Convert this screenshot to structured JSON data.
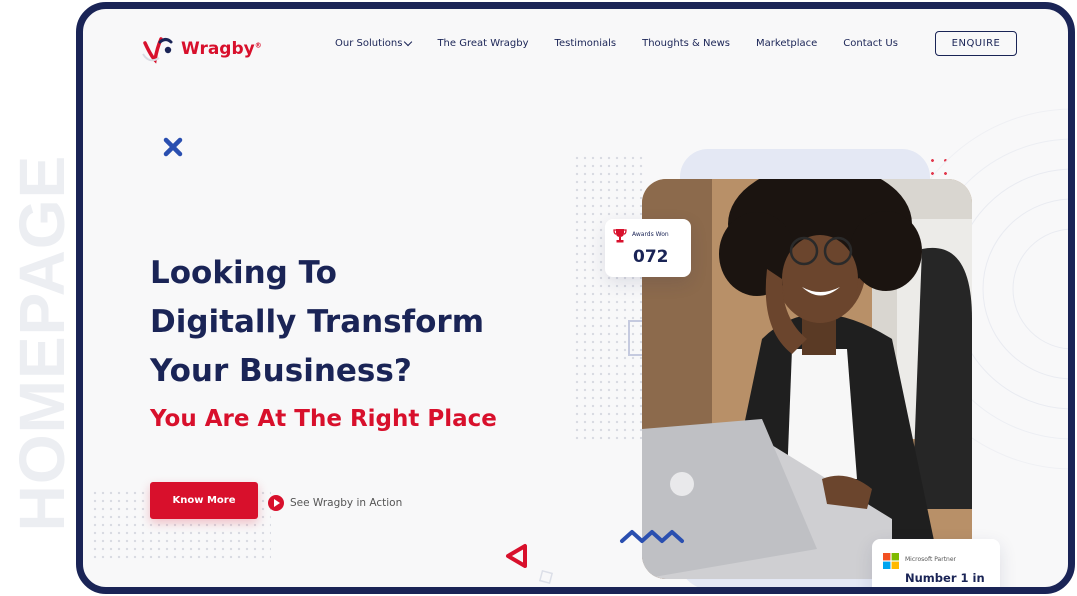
{
  "side_label": "HOMEPAGE",
  "brand": {
    "name": "Wragby",
    "mark": "®",
    "primary": "#1a2456",
    "accent": "#d8102c"
  },
  "nav": {
    "items": [
      {
        "label": "Our Solutions",
        "dropdown": true
      },
      {
        "label": "The Great Wragby"
      },
      {
        "label": "Testimonials"
      },
      {
        "label": "Thoughts & News"
      },
      {
        "label": "Marketplace"
      },
      {
        "label": "Contact Us"
      }
    ],
    "cta": "ENQUIRE"
  },
  "hero": {
    "headline_lines": [
      "Looking To",
      "Digitally Transform",
      "Your Business?"
    ],
    "subheadline": "You Are At The Right Place",
    "primary_button": "Know More",
    "secondary_link": "See Wragby in Action"
  },
  "awards_card": {
    "label": "Awards Won",
    "value": "072",
    "icon": "trophy-icon"
  },
  "partner_card": {
    "label": "Microsoft Partner",
    "value": "Number 1 in",
    "icon": "microsoft-logo-icon"
  }
}
